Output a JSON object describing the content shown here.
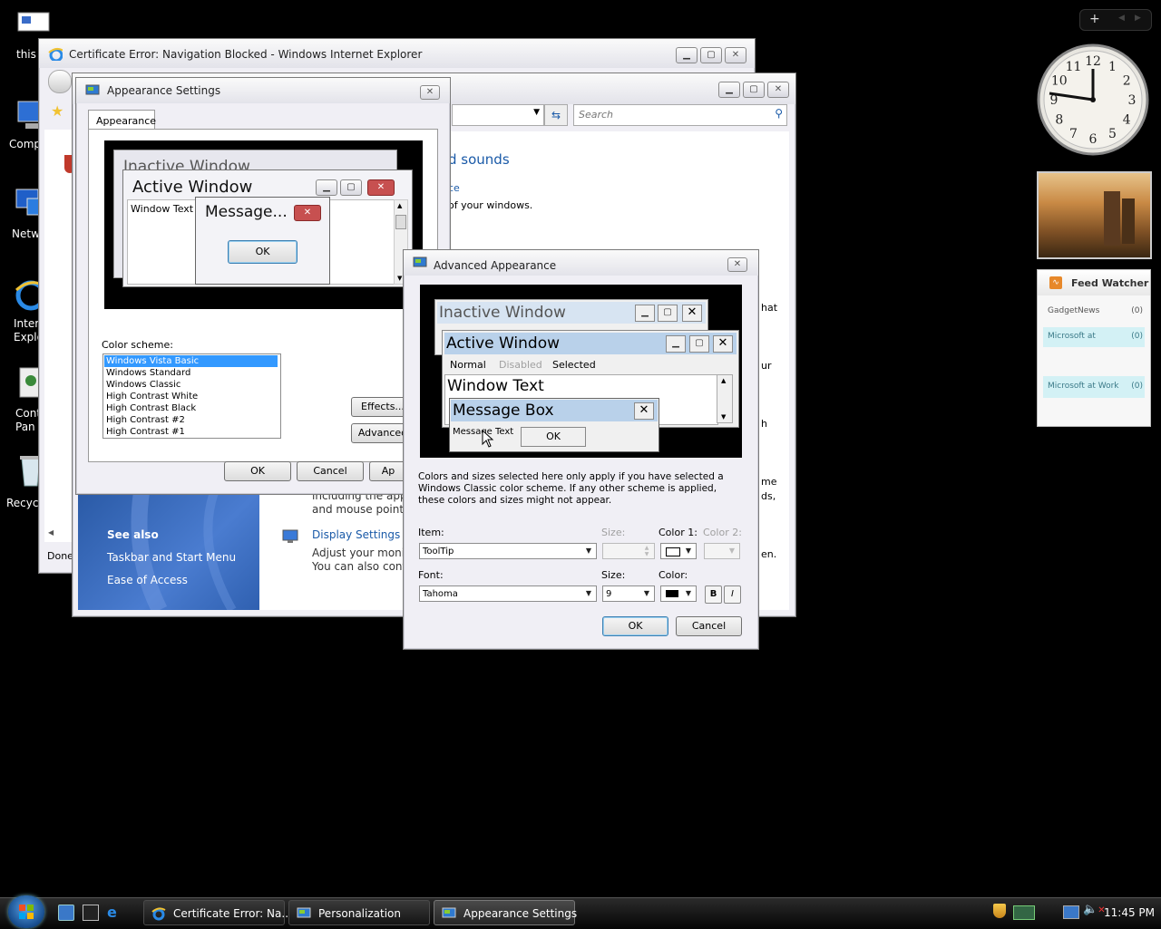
{
  "desktop": {
    "icons": [
      {
        "label": "this"
      },
      {
        "label": "Comp"
      },
      {
        "label": "Netw"
      },
      {
        "label": "Inter\nExplo"
      },
      {
        "label": "Cont\nPan"
      },
      {
        "label": "Recycl"
      }
    ]
  },
  "ie": {
    "title": "Certificate Error: Navigation Blocked - Windows Internet Explorer",
    "status": "Done"
  },
  "personalization": {
    "search_placeholder": "Search",
    "heading_fragment": "d sounds",
    "link_fragment": "ce",
    "text_fragment": "of your windows.",
    "right_fragments": [
      "hat",
      "ur",
      "h",
      "me",
      "ds,",
      "en."
    ],
    "body_line1": "including the appe",
    "body_line2": "and mouse pointer",
    "see_also": "See also",
    "see_also_links": [
      "Taskbar and Start Menu",
      "Ease of Access"
    ],
    "display_settings": "Display Settings",
    "display_desc1": "Adjust your monito",
    "display_desc2": "You can also contr"
  },
  "appearance": {
    "title": "Appearance Settings",
    "tab": "Appearance",
    "preview": {
      "inactive": "Inactive Window",
      "active": "Active Window",
      "window_text": "Window Text",
      "message": "Message...",
      "ok": "OK"
    },
    "color_scheme_label": "Color scheme:",
    "schemes": [
      "Windows Vista Basic",
      "Windows Standard",
      "Windows Classic",
      "High Contrast White",
      "High Contrast Black",
      "High Contrast #2",
      "High Contrast #1"
    ],
    "effects": "Effects...",
    "advanced": "Advanced",
    "ok": "OK",
    "cancel": "Cancel",
    "apply": "Ap"
  },
  "advanced": {
    "title": "Advanced Appearance",
    "preview": {
      "inactive": "Inactive Window",
      "active": "Active Window",
      "menu_normal": "Normal",
      "menu_disabled": "Disabled",
      "menu_selected": "Selected",
      "window_text": "Window Text",
      "message_box": "Message Box",
      "message_text": "Message Text",
      "ok": "OK"
    },
    "info": "Colors and sizes selected here only apply if you have selected a Windows Classic color scheme. If any other scheme is applied, these colors and sizes might not appear.",
    "item_label": "Item:",
    "item_value": "ToolTip",
    "size_label": "Size:",
    "color1_label": "Color 1:",
    "color2_label": "Color 2:",
    "font_label": "Font:",
    "font_value": "Tahoma",
    "font_size_label": "Size:",
    "font_size_value": "9",
    "font_color_label": "Color:",
    "bold": "B",
    "italic": "I",
    "ok": "OK",
    "cancel": "Cancel"
  },
  "sidebar": {
    "feed_title": "Feed Watcher",
    "feeds": [
      {
        "name": "GadgetNews",
        "count": "(0)"
      },
      {
        "name": "Microsoft at",
        "count": "(0)"
      },
      {
        "name": "Microsoft at Work",
        "count": "(0)"
      }
    ],
    "clock_numbers": [
      "12",
      "1",
      "2",
      "3",
      "4",
      "5",
      "6",
      "7",
      "8",
      "9",
      "10",
      "11"
    ]
  },
  "taskbar": {
    "buttons": [
      {
        "label": "Certificate Error: Na..."
      },
      {
        "label": "Personalization"
      },
      {
        "label": "Appearance Settings"
      }
    ],
    "time": "11:45 PM"
  },
  "colors": {
    "selected": "#3399ff",
    "active_caption": "#b9d1ea",
    "inactive_caption": "#d7e4f2",
    "link": "#1a5aa8",
    "close_red": "#c75050"
  }
}
